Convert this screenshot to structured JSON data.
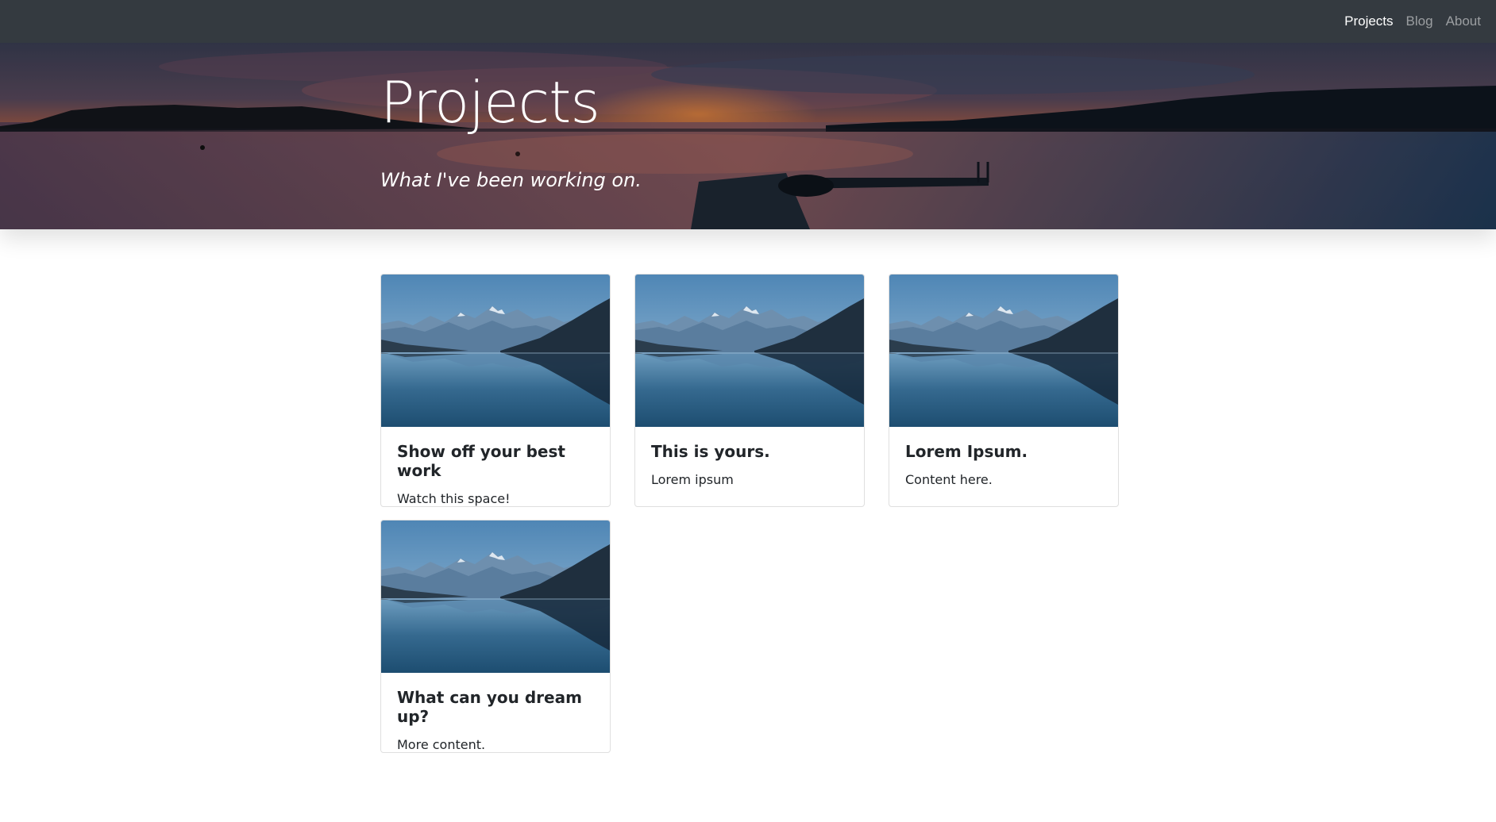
{
  "navbar": {
    "links": [
      {
        "label": "Projects",
        "active": true
      },
      {
        "label": "Blog",
        "active": false
      },
      {
        "label": "About",
        "active": false
      }
    ]
  },
  "hero": {
    "title": "Projects",
    "subtitle": "What I've been working on.",
    "image": "sunset-lake-dock"
  },
  "cards": [
    {
      "title": "Show off your best work",
      "text": "Watch this space!",
      "image": "mountain-lake-reflection"
    },
    {
      "title": "This is yours.",
      "text": "Lorem ipsum",
      "image": "mountain-lake-reflection"
    },
    {
      "title": "Lorem Ipsum.",
      "text": "Content here.",
      "image": "mountain-lake-reflection"
    },
    {
      "title": "What can you dream up?",
      "text": "More content.",
      "image": "mountain-lake-reflection"
    }
  ],
  "colors": {
    "navbar_bg": "#343a40",
    "nav_active": "#ffffff",
    "nav_inactive": "rgba(255,255,255,0.5)",
    "text": "#212529"
  }
}
